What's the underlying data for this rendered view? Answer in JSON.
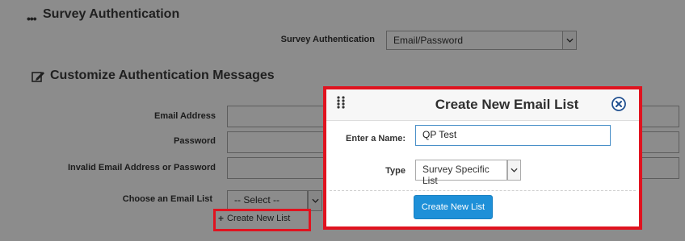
{
  "survey_auth": {
    "section_title": "Survey Authentication",
    "field_label": "Survey Authentication",
    "selected_value": "Email/Password"
  },
  "customize": {
    "section_title": "Customize Authentication Messages",
    "fields": [
      {
        "label": "Email Address"
      },
      {
        "label": "Password"
      },
      {
        "label": "Invalid Email Address or Password"
      }
    ],
    "email_list_label": "Choose an Email List",
    "email_list_selected": "-- Select --",
    "create_list_link": "Create New List"
  },
  "modal": {
    "title": "Create New Email List",
    "name_label": "Enter a Name:",
    "name_value": "QP Test",
    "type_label": "Type",
    "type_selected": "Survey Specific List",
    "submit_label": "Create New List"
  },
  "colors": {
    "highlight": "#e0131f",
    "primary_button": "#1e90d8",
    "close_icon": "#1f4f8f"
  }
}
